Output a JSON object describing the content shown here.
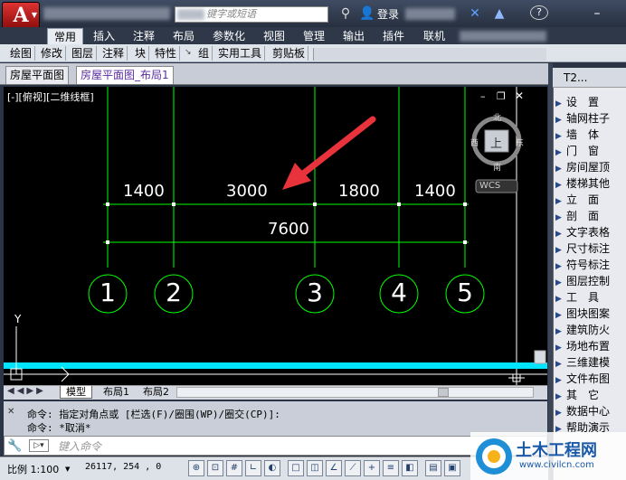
{
  "titlebar": {
    "app_button": "A",
    "search_placeholder": "键字或短语",
    "login_label": "登录",
    "icons": [
      "binoculars-icon",
      "user-icon",
      "exchange-icon",
      "triangle-app-icon",
      "help-icon",
      "minimize-icon"
    ]
  },
  "ribbon": {
    "tabs": [
      "常用",
      "插入",
      "注释",
      "布局",
      "参数化",
      "视图",
      "管理",
      "输出",
      "插件",
      "联机"
    ],
    "active_tab": "常用",
    "panels": [
      "绘图",
      "修改",
      "图层",
      "注释",
      "块",
      "特性",
      "组",
      "实用工具",
      "剪贴板"
    ]
  },
  "file_tabs": [
    "房屋平面图",
    "房屋平面图_布局1"
  ],
  "viewport": {
    "label": "[-][俯视][二维线框]",
    "viewcube": {
      "north": "北",
      "south": "南",
      "west": "西",
      "east": "东",
      "top": "上",
      "wcs": "WCS"
    }
  },
  "drawing": {
    "dimensions": [
      "1400",
      "3000",
      "1800",
      "1400"
    ],
    "total_dimension": "7600",
    "axis_numbers": [
      "1",
      "2",
      "3",
      "4",
      "5"
    ],
    "ucs_label": "Y"
  },
  "layout_tabs": [
    "模型",
    "布局1",
    "布局2"
  ],
  "command": {
    "line1": "命令: 指定对角点或 [栏选(F)/圈围(WP)/圈交(CP)]:",
    "line2": "命令: *取消*",
    "input_placeholder": "键入命令"
  },
  "statusbar": {
    "scale": "比例 1:100",
    "coords": "26117, 254 , 0"
  },
  "palette": {
    "title": "T2...",
    "items": [
      "设　置",
      "轴网柱子",
      "墙　体",
      "门　窗",
      "房间屋顶",
      "楼梯其他",
      "立　面",
      "剖　面",
      "文字表格",
      "尺寸标注",
      "符号标注",
      "图层控制",
      "工　具",
      "图块图案",
      "建筑防火",
      "场地布置",
      "三维建模",
      "文件布图",
      "其　它",
      "数据中心",
      "帮助演示"
    ]
  },
  "watermark": {
    "brand": "土木工程网",
    "url": "www.civilcn.com"
  },
  "colors": {
    "background": "#000000",
    "dimension_lines": "#00ff00",
    "text": "#ffffff",
    "arrow": "#e8323c",
    "cyan_line": "#00e5ff"
  }
}
